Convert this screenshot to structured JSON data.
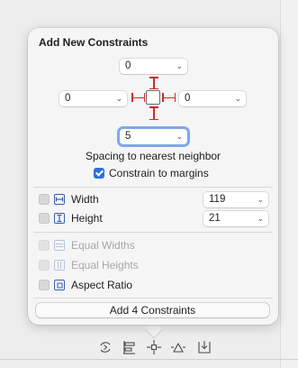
{
  "popover": {
    "title": "Add New Constraints",
    "top_value": "0",
    "left_value": "0",
    "right_value": "0",
    "bottom_value": "5",
    "spacing_label": "Spacing to nearest neighbor",
    "constrain_margins_label": "Constrain to margins",
    "constrain_margins_checked": true,
    "width_label": "Width",
    "width_value": "119",
    "height_label": "Height",
    "height_value": "21",
    "equal_widths_label": "Equal Widths",
    "equal_heights_label": "Equal Heights",
    "aspect_ratio_label": "Aspect Ratio",
    "add_button_label": "Add 4 Constraints"
  },
  "toolbar": {
    "icons": [
      "update-frames-icon",
      "align-icon",
      "add-constraints-icon",
      "resolve-issues-icon",
      "embed-in-icon"
    ]
  },
  "colors": {
    "strut": "#cc2a2a",
    "accent": "#2f6fd6"
  }
}
